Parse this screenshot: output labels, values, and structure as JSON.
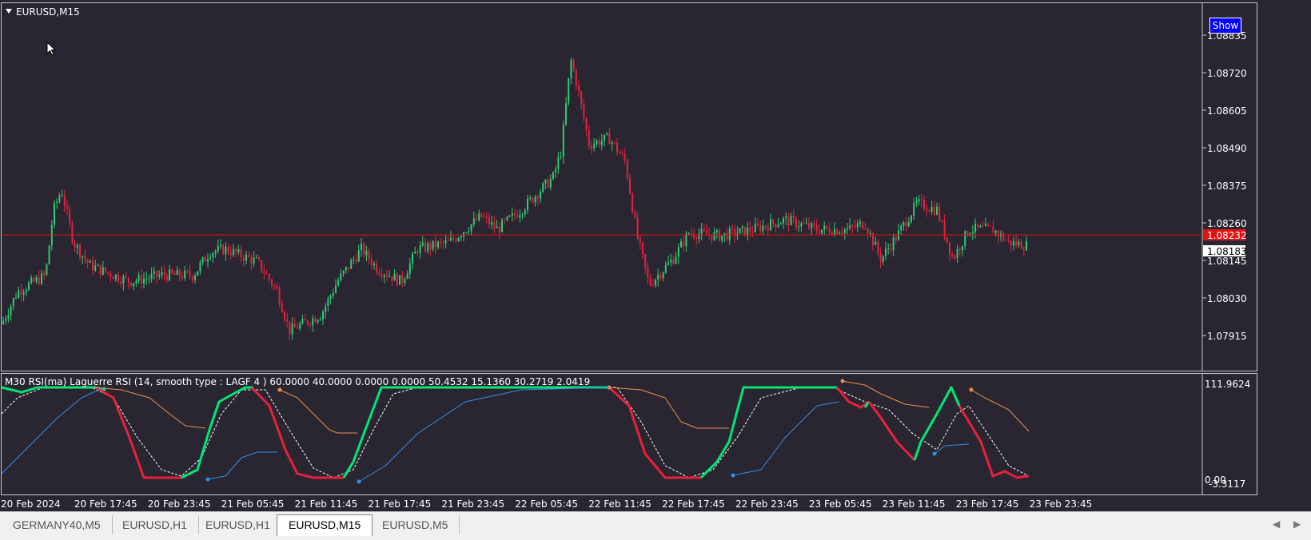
{
  "main_chart": {
    "symbol_title": "EURUSD,M15",
    "show_button": "Show",
    "price_labels": [
      "1.08835",
      "1.08720",
      "1.08605",
      "1.08490",
      "1.08375",
      "1.08260",
      "1.08145",
      "1.08030",
      "1.07915"
    ],
    "current_price": "1.08232",
    "bid_price": "1.08183"
  },
  "indicator": {
    "title": "M30 RSI(ma) Laguerre RSI (14, smooth type :  LAGF  4 ) 60.0000 40.0000 0.0000 0.0000 50.4532 15.1360 30.2719 2.0419",
    "scale_top": "111.9624",
    "scale_bottom_a": "0.00",
    "scale_bottom_b": "-3.3117"
  },
  "time_labels": [
    "20 Feb 2024",
    "20 Feb 17:45",
    "20 Feb 23:45",
    "21 Feb 05:45",
    "21 Feb 11:45",
    "21 Feb 17:45",
    "21 Feb 23:45",
    "22 Feb 05:45",
    "22 Feb 11:45",
    "22 Feb 17:45",
    "22 Feb 23:45",
    "23 Feb 05:45",
    "23 Feb 11:45",
    "23 Feb 17:45",
    "23 Feb 23:45"
  ],
  "tabs": [
    {
      "label": "GERMANY40,M5",
      "active": false
    },
    {
      "label": "EURUSD,H1",
      "active": false
    },
    {
      "label": "EURUSD,H1",
      "active": false
    },
    {
      "label": "EURUSD,M15",
      "active": true
    },
    {
      "label": "EURUSD,M5",
      "active": false
    }
  ],
  "colors": {
    "bull": "#2ecc71",
    "bear": "#e8203c",
    "price_line": "#d21414",
    "rsi_up": "#00e676",
    "rsi_down": "#e8203c",
    "orange": "#e8914a",
    "blue": "#2f8de8"
  }
}
